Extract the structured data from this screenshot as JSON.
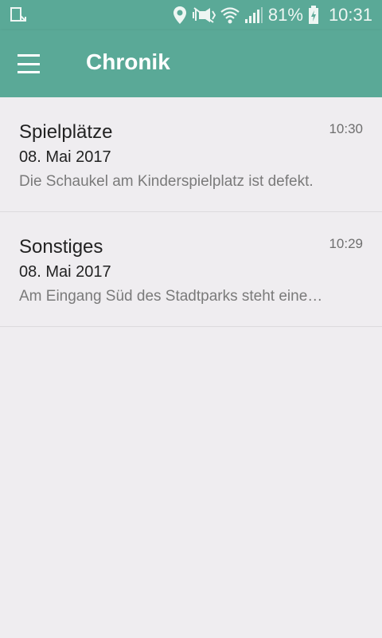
{
  "status_bar": {
    "battery": "81%",
    "time": "10:31",
    "icons": [
      "download-notification-icon",
      "location-icon",
      "vibrate-icon",
      "wifi-icon",
      "signal-icon",
      "battery-charging-icon"
    ]
  },
  "app_bar": {
    "title": "Chronik",
    "menu_icon": "menu-icon"
  },
  "colors": {
    "primary": "#5aa997",
    "background": "#efedf0"
  },
  "history": [
    {
      "category": "Spielplätze",
      "date": "08. Mai 2017",
      "time": "10:30",
      "text": "Die Schaukel am Kinderspielplatz ist defekt."
    },
    {
      "category": "Sonstiges",
      "date": "08. Mai 2017",
      "time": "10:29",
      "text": "Am Eingang Süd des Stadtparks steht eine…"
    }
  ]
}
